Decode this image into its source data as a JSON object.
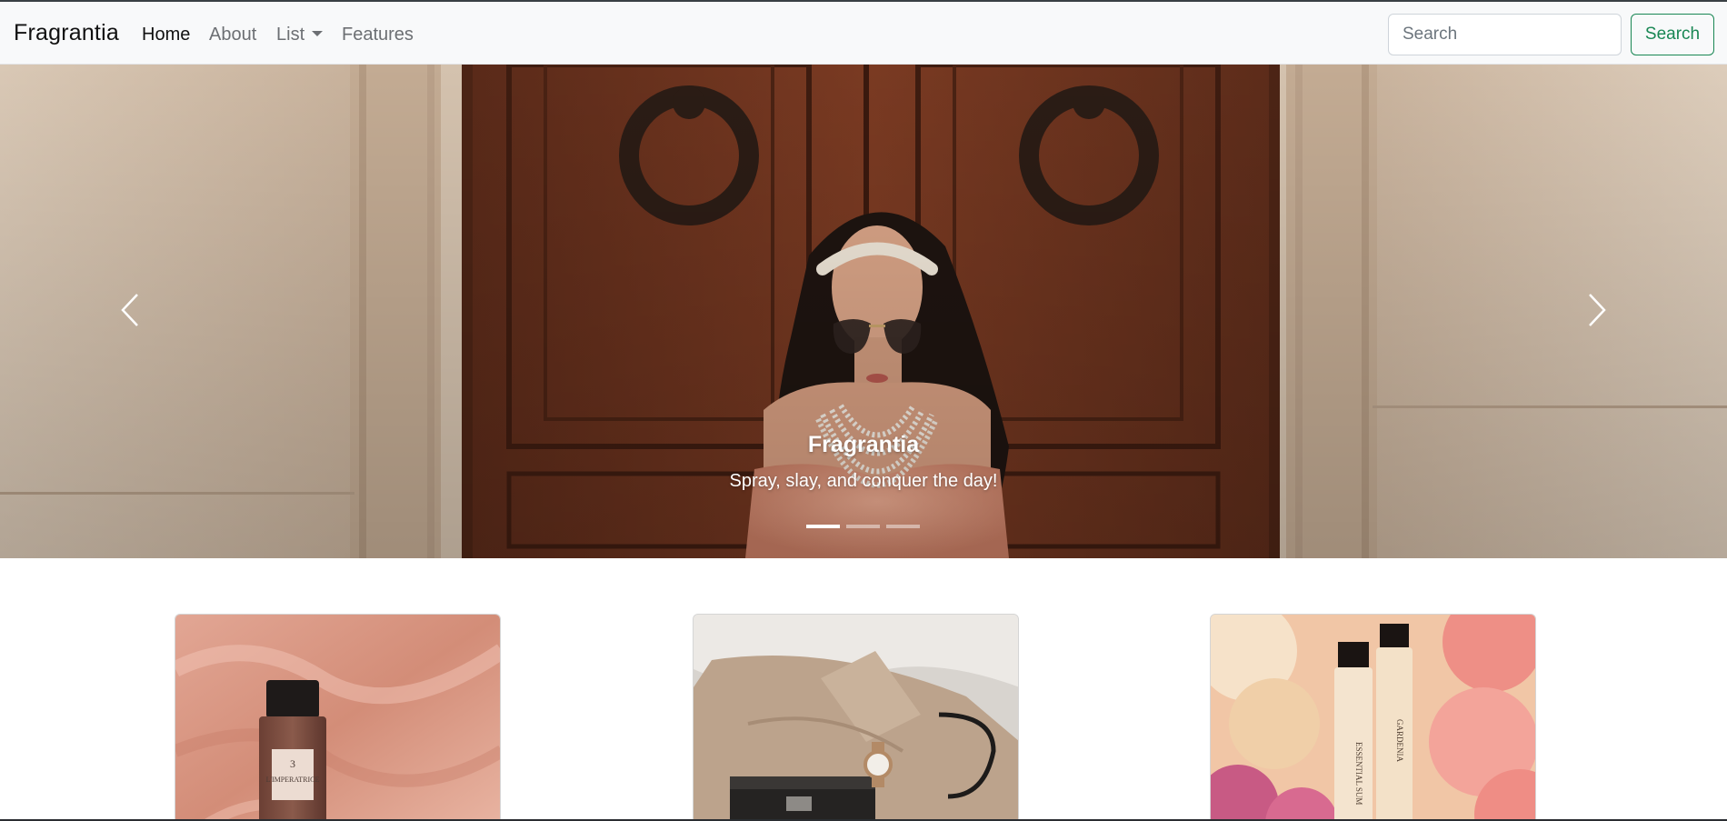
{
  "navbar": {
    "brand": "Fragrantia",
    "links": [
      {
        "label": "Home",
        "active": true
      },
      {
        "label": "About",
        "active": false
      },
      {
        "label": "List",
        "dropdown": true
      },
      {
        "label": "Features",
        "active": false
      }
    ],
    "search": {
      "placeholder": "Search",
      "button_label": "Search"
    }
  },
  "carousel": {
    "slide": {
      "title": "Fragrantia",
      "subtitle": "Spray, slay, and conquer the day!"
    },
    "indicator_count": 3,
    "active_indicator": 1,
    "controls": {
      "prev_icon": "chevron-left-icon",
      "next_icon": "chevron-right-icon"
    }
  },
  "cards": [
    {
      "image": "perfume-bottle-on-pink-silk",
      "bottle_text": "3",
      "bottle_label": "L'IMPERATRICE"
    },
    {
      "image": "handbag-and-watch-on-coat"
    },
    {
      "image": "perfume-vials-with-peonies",
      "vial_labels": [
        "ESSENTIAL SUM",
        "GARDENIA"
      ]
    }
  ],
  "colors": {
    "accent": "#198754",
    "navbar_bg": "#f8f9fa"
  }
}
